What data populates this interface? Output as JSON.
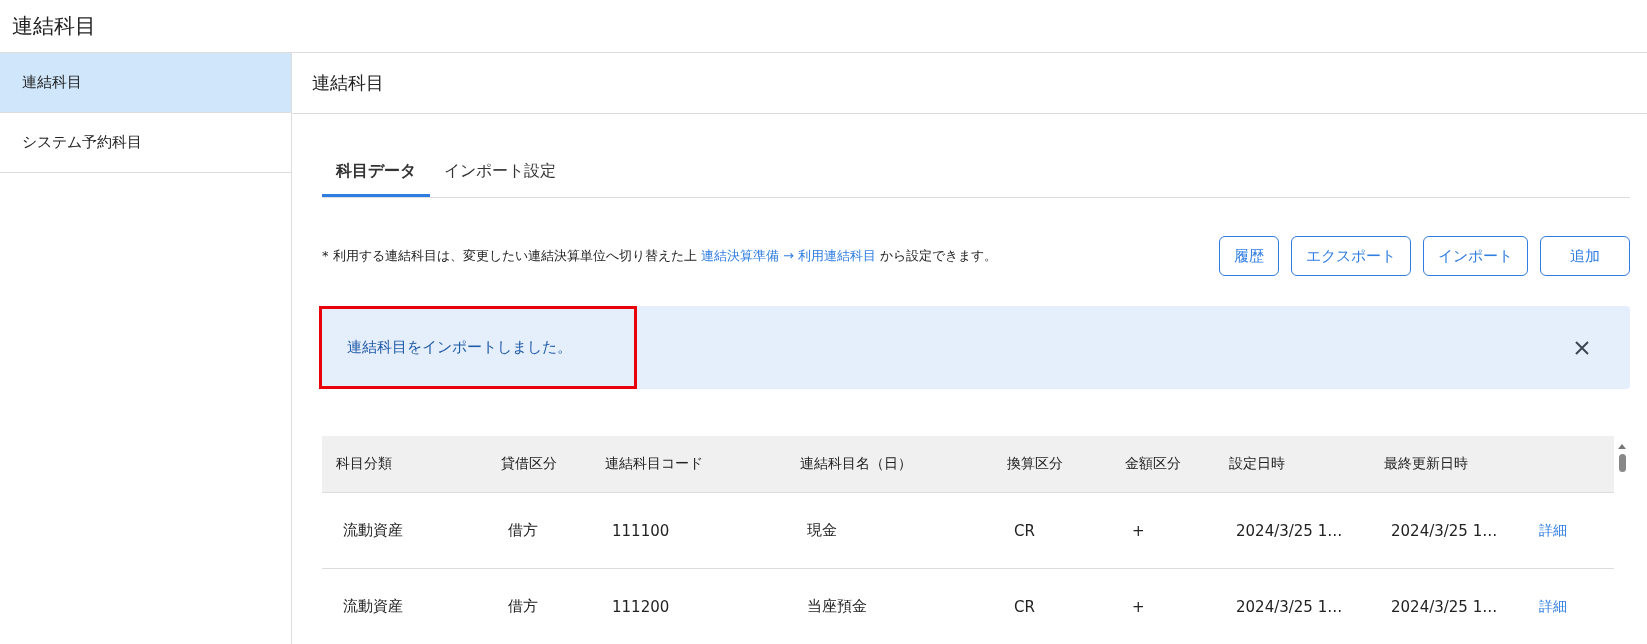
{
  "app_title": "連結科目",
  "sidebar": {
    "items": [
      {
        "label": "連結科目",
        "selected": true
      },
      {
        "label": "システム予約科目",
        "selected": false
      }
    ]
  },
  "page_title": "連結科目",
  "tabs": [
    {
      "label": "科目データ",
      "selected": true
    },
    {
      "label": "インポート設定",
      "selected": false
    }
  ],
  "note": {
    "before": "* 利用する連結科目は、変更したい連結決算単位へ切り替えた上",
    "link": "連結決算準備 → 利用連結科目",
    "after": "から設定できます。"
  },
  "buttons": [
    "履歴",
    "エクスポート",
    "インポート",
    "追加"
  ],
  "alert": {
    "message": "連結科目をインポートしました。",
    "highlighted": true
  },
  "table": {
    "columns": [
      "科目分類",
      "貸借区分",
      "連結科目コード",
      "連結科目名（日）",
      "換算区分",
      "金額区分",
      "設定日時",
      "最終更新日時"
    ],
    "rows": [
      {
        "cells": [
          "流動資産",
          "借方",
          "111100",
          "現金",
          "CR",
          "+",
          "2024/3/25 1…",
          "2024/3/25 1…"
        ],
        "action": "詳細"
      },
      {
        "cells": [
          "流動資産",
          "借方",
          "111200",
          "当座預金",
          "CR",
          "+",
          "2024/3/25 1…",
          "2024/3/25 1…"
        ],
        "action": "詳細"
      }
    ]
  }
}
